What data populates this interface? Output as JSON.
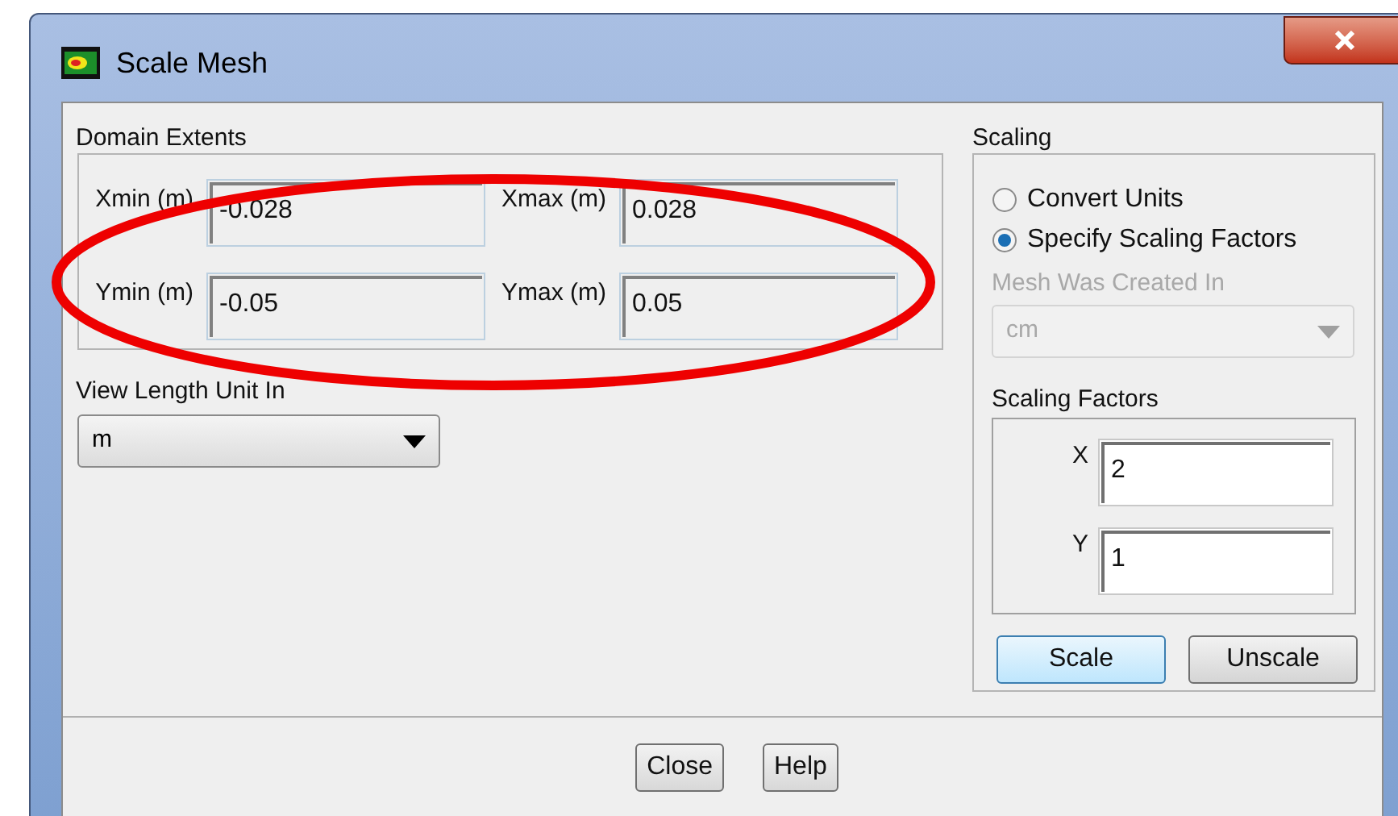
{
  "window": {
    "title": "Scale Mesh"
  },
  "domain_extents": {
    "title": "Domain Extents",
    "fields": [
      {
        "label": "Xmin (m)",
        "value": "-0.028"
      },
      {
        "label": "Xmax (m)",
        "value": "0.028"
      },
      {
        "label": "Ymin (m)",
        "value": "-0.05"
      },
      {
        "label": "Ymax (m)",
        "value": "0.05"
      }
    ]
  },
  "view_length_unit": {
    "label": "View Length Unit In",
    "value": "m"
  },
  "scaling": {
    "title": "Scaling",
    "options": [
      {
        "label": "Convert Units",
        "selected": false
      },
      {
        "label": "Specify Scaling Factors",
        "selected": true
      }
    ],
    "mesh_created_in": {
      "label": "Mesh Was Created In",
      "value": "cm",
      "disabled": true
    },
    "factors": {
      "title": "Scaling Factors",
      "fields": [
        {
          "label": "X",
          "value": "2"
        },
        {
          "label": "Y",
          "value": "1"
        }
      ]
    },
    "buttons": [
      "Scale",
      "Unscale"
    ]
  },
  "buttons": [
    "Close",
    "Help"
  ],
  "annotation": {
    "kind": "ellipse"
  }
}
